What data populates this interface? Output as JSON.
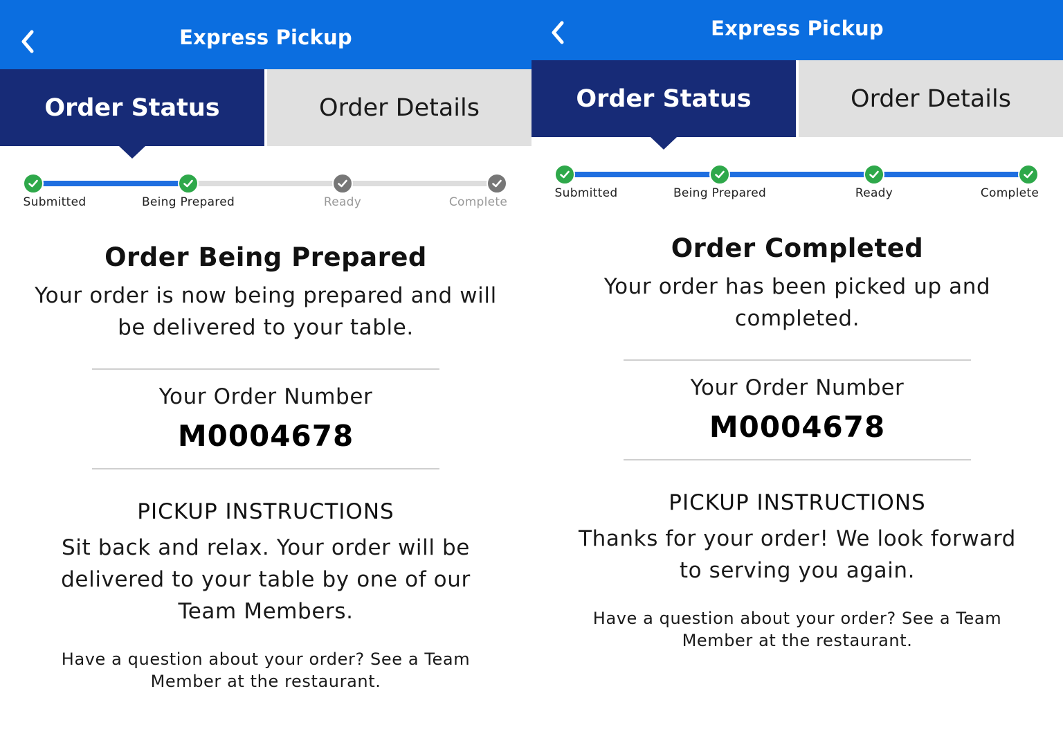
{
  "left": {
    "header": {
      "title": "Express Pickup"
    },
    "tabs": {
      "active": "Order Status",
      "inactive": "Order Details"
    },
    "progress": {
      "steps": [
        {
          "label": "Submitted",
          "done": true
        },
        {
          "label": "Being Prepared",
          "done": true
        },
        {
          "label": "Ready",
          "done": false
        },
        {
          "label": "Complete",
          "done": false
        }
      ]
    },
    "status": {
      "heading": "Order Being Prepared",
      "message": "Your order is now being prepared and will be delivered to your table."
    },
    "order": {
      "label": "Your Order Number",
      "number": "M0004678"
    },
    "instructions": {
      "title": "PICKUP INSTRUCTIONS",
      "text": "Sit back and relax. Your order will be delivered to your table by one of our Team Members."
    },
    "help_text": "Have a question about your order? See a Team Member at the restaurant."
  },
  "right": {
    "header": {
      "title": "Express Pickup"
    },
    "tabs": {
      "active": "Order Status",
      "inactive": "Order Details"
    },
    "progress": {
      "steps": [
        {
          "label": "Submitted",
          "done": true
        },
        {
          "label": "Being Prepared",
          "done": true
        },
        {
          "label": "Ready",
          "done": true
        },
        {
          "label": "Complete",
          "done": true
        }
      ]
    },
    "status": {
      "heading": "Order Completed",
      "message": "Your order has been picked up and completed."
    },
    "order": {
      "label": "Your Order Number",
      "number": "M0004678"
    },
    "instructions": {
      "title": "PICKUP INSTRUCTIONS",
      "text": "Thanks for your order! We look forward to serving you again."
    },
    "help_text": "Have a question about your order? See a Team Member at the restaurant."
  },
  "icons": {
    "back": "chevron-left-icon",
    "step": "check-icon"
  },
  "colors": {
    "header_blue": "#0b6ee0",
    "tab_active": "#172b77",
    "tab_inactive": "#e0e0e0",
    "progress_active": "#1f6fe0",
    "progress_inactive": "#dddddd",
    "step_done": "#2ea84a",
    "step_todo": "#777777"
  }
}
